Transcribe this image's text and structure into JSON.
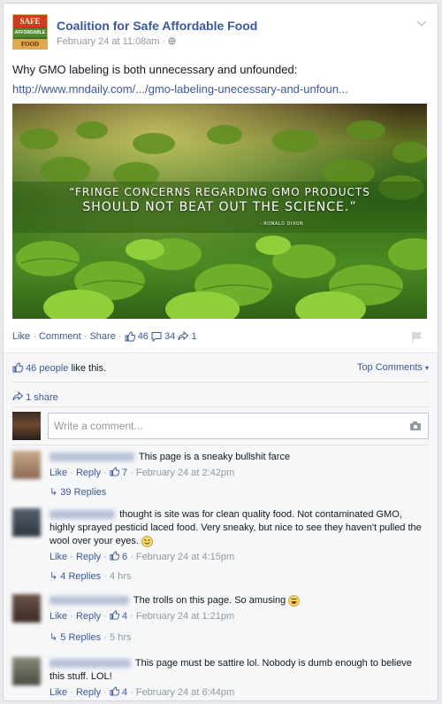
{
  "post": {
    "page_name": "Coalition for Safe Affordable Food",
    "timestamp": "February 24 at 11:08am",
    "privacy_separator": "·",
    "text": "Why GMO labeling is both unnecessary and unfounded:",
    "url": "http://www.mndaily.com/.../gmo-labeling-unecessary-and-unfoun...",
    "logo": {
      "line1": "SAFE",
      "line2": "AFFORDABLE",
      "line3": "FOOD"
    },
    "image_quote": {
      "line1": "“FRINGE CONCERNS REGARDING GMO PRODUCTS",
      "line2": "SHOULD NOT BEAT OUT THE SCIENCE.”",
      "attribution": "- RONALD DIXON"
    }
  },
  "actions": {
    "like": "Like",
    "comment": "Comment",
    "share": "Share",
    "sep": "·",
    "like_count": "46",
    "comment_count": "34",
    "share_count": "1"
  },
  "feedback": {
    "likes_link": "46 people",
    "likes_suffix": " like this.",
    "top_comments": "Top Comments",
    "shares": "1 share",
    "input_placeholder": "Write a comment..."
  },
  "comments": [
    {
      "text": "This page is a sneaky bullshit farce",
      "reply": "Reply",
      "like": "Like",
      "likes": "7",
      "time": "February 24 at 2:42pm",
      "replies": "39 Replies",
      "replies_age": ""
    },
    {
      "text": "thought is site was for clean quality food. Not contaminated GMO, highly sprayed pesticid laced food. Very sneaky, but nice to see they haven't pulled the wool over your eyes.",
      "reply": "Reply",
      "like": "Like",
      "likes": "6",
      "time": "February 24 at 4:15pm",
      "replies": "4 Replies",
      "replies_age": "4 hrs"
    },
    {
      "text": "The trolls on this page. So amusing",
      "reply": "Reply",
      "like": "Like",
      "likes": "4",
      "time": "February 24 at 1:21pm",
      "replies": "5 Replies",
      "replies_age": "5 hrs"
    },
    {
      "text": "This page must be sattire lol. Nobody is dumb enough to believe this stuff. LOL!",
      "reply": "Reply",
      "like": "Like",
      "likes": "4",
      "time": "February 24 at 6:44pm",
      "replies": "",
      "replies_age": ""
    }
  ],
  "colors": {
    "link": "#3b5998",
    "muted": "#9197a3",
    "background": "#e9eaed"
  },
  "icons": [
    "chevron-down-icon",
    "globe-icon",
    "thumbs-up-icon",
    "speech-bubble-icon",
    "share-arrow-icon",
    "flag-icon",
    "camera-icon",
    "reply-arrow-icon",
    "smiley-icon",
    "laughing-icon"
  ]
}
